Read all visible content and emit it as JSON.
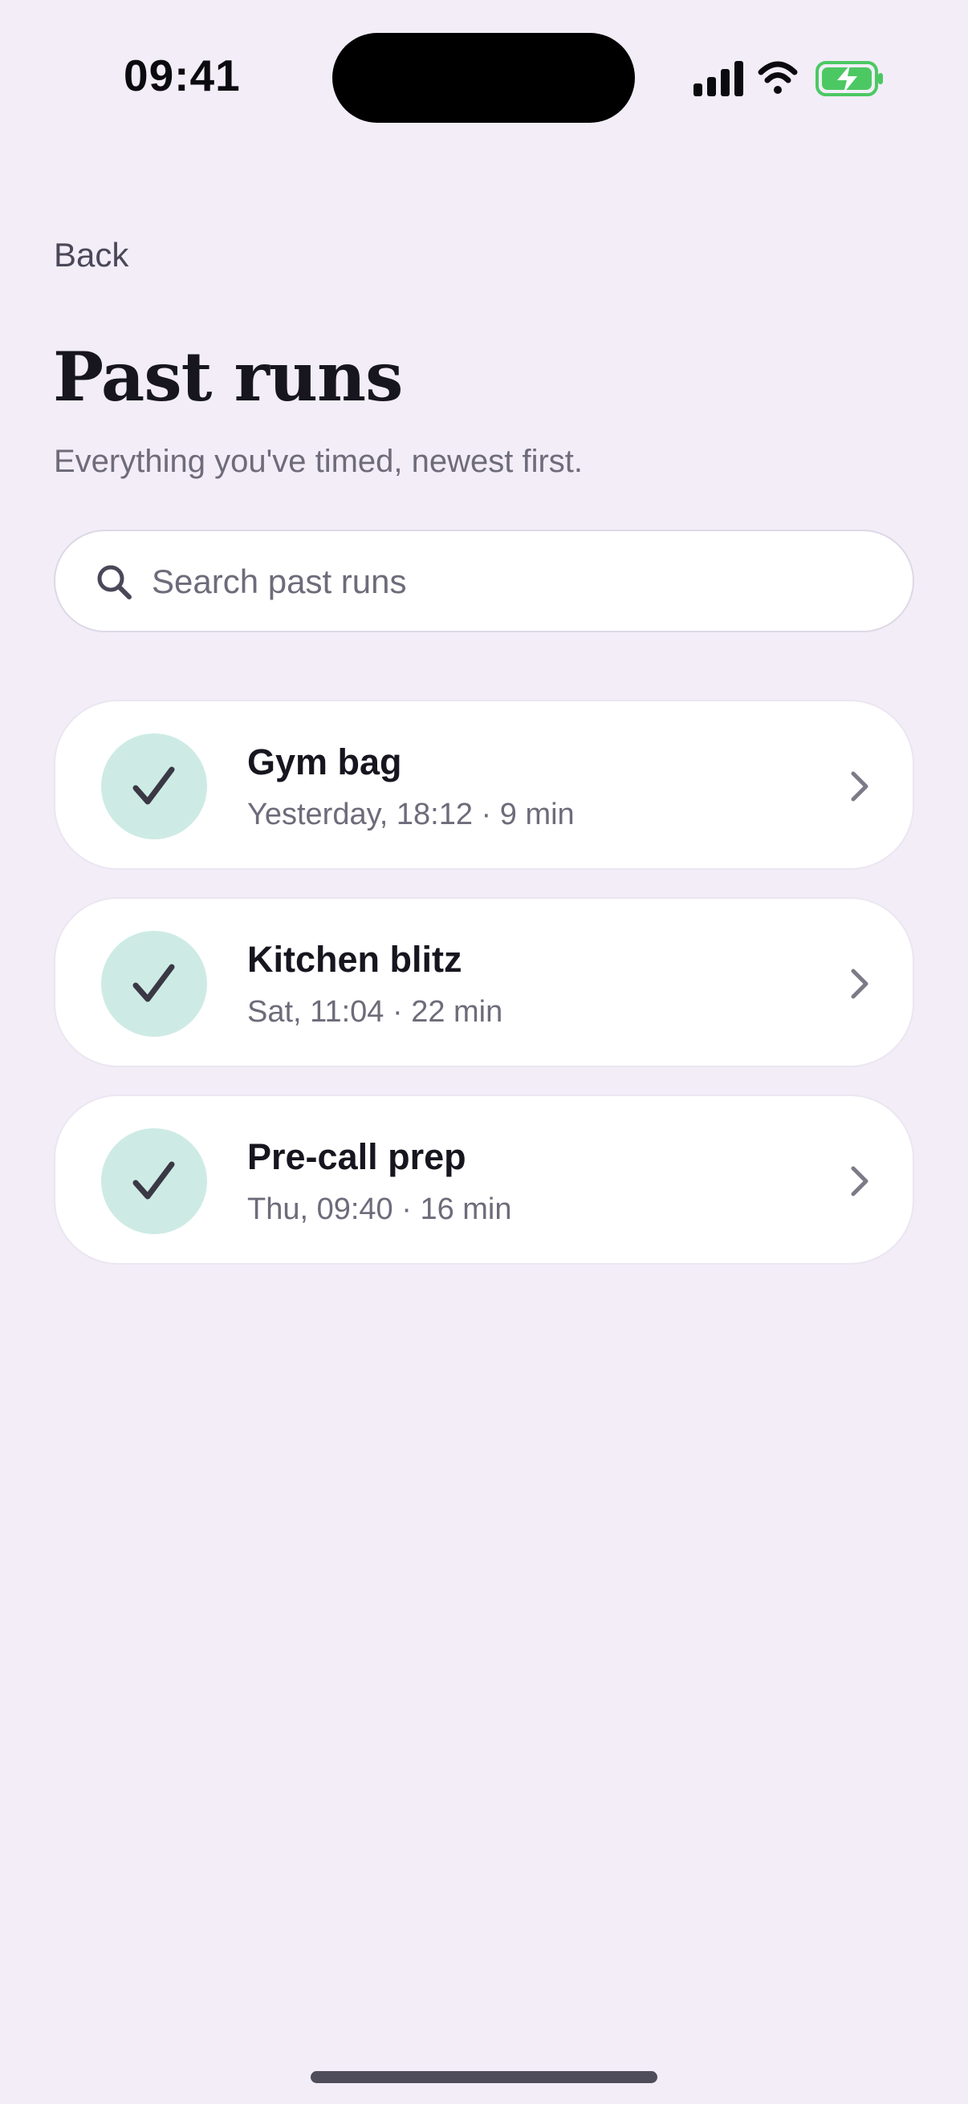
{
  "status_bar": {
    "time": "09:41",
    "icons": [
      "cellular-signal-icon",
      "wifi-icon",
      "battery-charging-icon"
    ],
    "battery_color": "#4cc863"
  },
  "nav": {
    "back_label": "Back"
  },
  "header": {
    "title": "Past runs",
    "subtitle": "Everything you've timed, newest first."
  },
  "search": {
    "placeholder": "Search past runs",
    "value": "",
    "icon": "search-icon"
  },
  "runs": [
    {
      "name": "Gym bag",
      "meta": "Yesterday, 18:12 · 9 min",
      "status_icon": "checkmark-icon"
    },
    {
      "name": "Kitchen blitz",
      "meta": "Sat, 11:04 · 22 min",
      "status_icon": "checkmark-icon"
    },
    {
      "name": "Pre-call prep",
      "meta": "Thu, 09:40 · 16 min",
      "status_icon": "checkmark-icon"
    }
  ],
  "colors": {
    "background": "#f2edf7",
    "card": "#ffffff",
    "badge": "#cdebe4",
    "text_primary": "#17161f",
    "text_secondary": "#6e6b7a"
  }
}
